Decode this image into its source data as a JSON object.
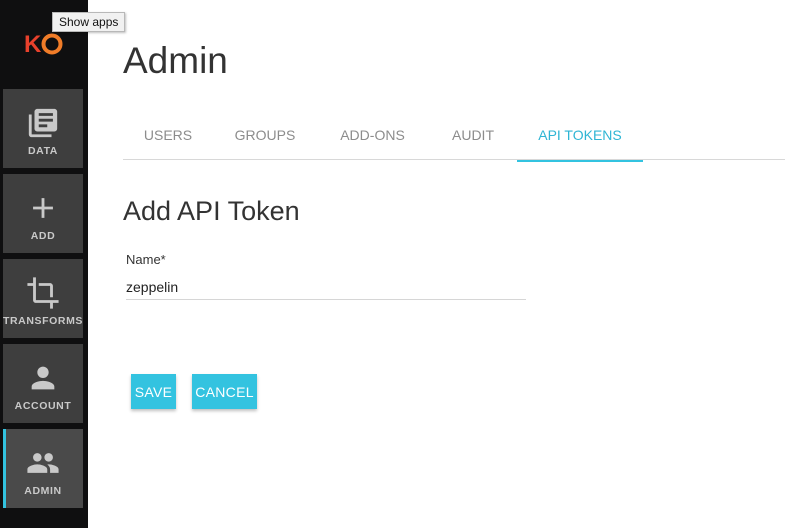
{
  "tooltip": "Show apps",
  "logo": {
    "text": "KO",
    "color_k": "#e8412c",
    "color_o": "#f07c28"
  },
  "sidebar": {
    "items": [
      {
        "label": "DATA",
        "icon": "library-books-icon"
      },
      {
        "label": "ADD",
        "icon": "plus-icon"
      },
      {
        "label": "TRANSFORMS",
        "icon": "crop-icon"
      },
      {
        "label": "ACCOUNT",
        "icon": "person-icon"
      },
      {
        "label": "ADMIN",
        "icon": "people-icon",
        "active": true
      }
    ]
  },
  "main": {
    "title": "Admin",
    "tabs": [
      {
        "label": "USERS"
      },
      {
        "label": "GROUPS"
      },
      {
        "label": "ADD-ONS"
      },
      {
        "label": "AUDIT"
      },
      {
        "label": "API TOKENS",
        "active": true
      }
    ],
    "form": {
      "title": "Add API Token",
      "name_label": "Name*",
      "name_value": "zeppelin",
      "save_label": "SAVE",
      "cancel_label": "CANCEL"
    }
  },
  "colors": {
    "accent": "#33c3e0",
    "sidebar_bg": "#0f0f10",
    "nav_tile": "#3e3e3e"
  }
}
